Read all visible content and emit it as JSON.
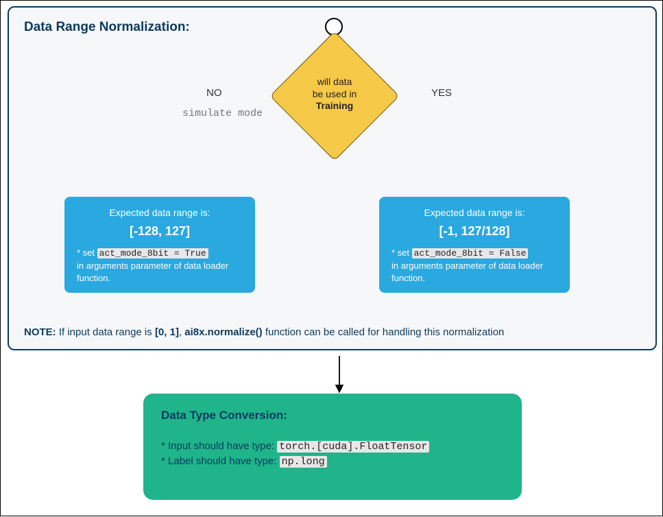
{
  "title": "Data Range Normalization:",
  "decision": {
    "line1": "will data",
    "line2": "be used in",
    "line3": "Training"
  },
  "branches": {
    "no": "NO",
    "yes": "YES",
    "simulate": "simulate mode"
  },
  "left_box": {
    "expected": "Expected data range is:",
    "range": "[-128, 127]",
    "set_prefix": "* set ",
    "code": "act_mode_8bit = True",
    "tail": "in arguments parameter of data loader function."
  },
  "right_box": {
    "expected": "Expected data range is:",
    "range": "[-1, 127/128]",
    "set_prefix": "* set ",
    "code": "act_mode_8bit = False",
    "tail": "in arguments parameter of data loader function."
  },
  "note": {
    "prefix": "NOTE:",
    "mid1": " If input data range is ",
    "bold_range": "[0, 1]",
    "mid2": ", ",
    "bold_fn": "ai8x.normalize()",
    "tail": " function can be called for handling this normalization"
  },
  "green": {
    "header": "Data Type Conversion:",
    "input_label": "* Input should have type: ",
    "input_code": "torch.[cuda].FloatTensor",
    "label_label": "* Label should have type: ",
    "label_code": "np.long"
  }
}
